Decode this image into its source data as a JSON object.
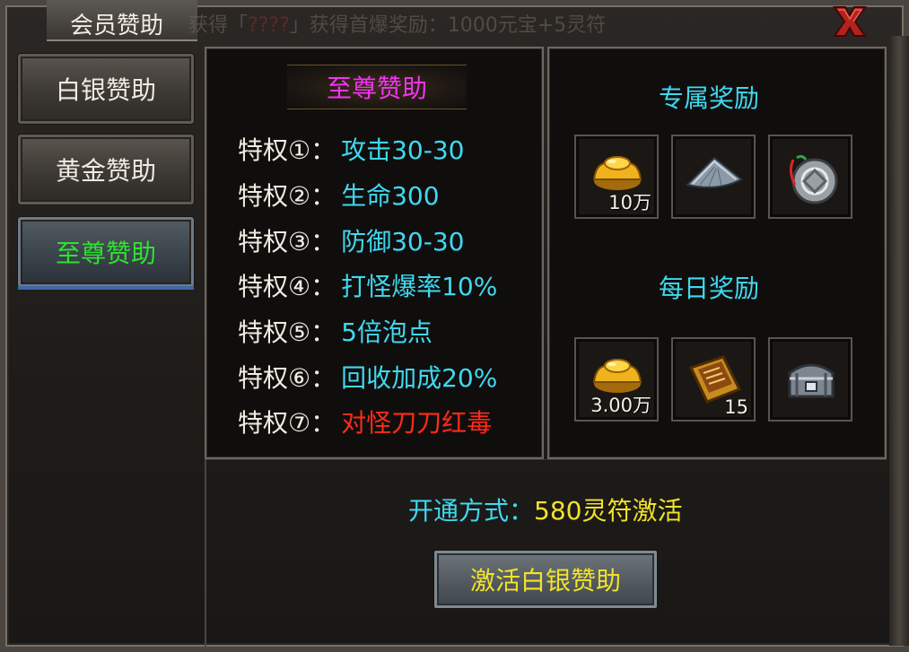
{
  "window": {
    "title": "会员赞助"
  },
  "ticker": {
    "prefix": "获得「",
    "item": "????",
    "suffix": "」获得首爆奖励：1000元宝+5灵符"
  },
  "sidebar": {
    "items": [
      {
        "label": "白银赞助"
      },
      {
        "label": "黄金赞助"
      },
      {
        "label": "至尊赞助",
        "active": true
      }
    ]
  },
  "section": {
    "title": "至尊赞助"
  },
  "privileges": [
    {
      "label": "特权①：",
      "value": "攻击30-30"
    },
    {
      "label": "特权②：",
      "value": "生命300"
    },
    {
      "label": "特权③：",
      "value": "防御30-30"
    },
    {
      "label": "特权④：",
      "value": "打怪爆率10%"
    },
    {
      "label": "特权⑤：",
      "value": "5倍泡点"
    },
    {
      "label": "特权⑥：",
      "value": "回收加成20%"
    },
    {
      "label": "特权⑦：",
      "value": "对怪刀刀红毒"
    }
  ],
  "exclusive": {
    "title": "专属奖励",
    "items": [
      {
        "icon": "gold-ingot-icon",
        "qty": "10万"
      },
      {
        "icon": "bamboo-hat-icon",
        "qty": ""
      },
      {
        "icon": "medal-icon",
        "qty": ""
      }
    ]
  },
  "daily": {
    "title": "每日奖励",
    "items": [
      {
        "icon": "gold-ingot-icon",
        "qty": "3.00万"
      },
      {
        "icon": "skill-book-icon",
        "qty": "15"
      },
      {
        "icon": "treasure-chest-icon",
        "qty": ""
      }
    ]
  },
  "activation": {
    "label": "开通方式：",
    "value": "580灵符激活"
  },
  "activate_button": {
    "label": "激活白银赞助"
  },
  "colors": {
    "privilege_value": "#3fd9f0",
    "privilege_special": "#ff2a1a",
    "section_title": "#f333f3",
    "active_tab": "#2ee32e",
    "gold_text": "#f2e22a"
  }
}
